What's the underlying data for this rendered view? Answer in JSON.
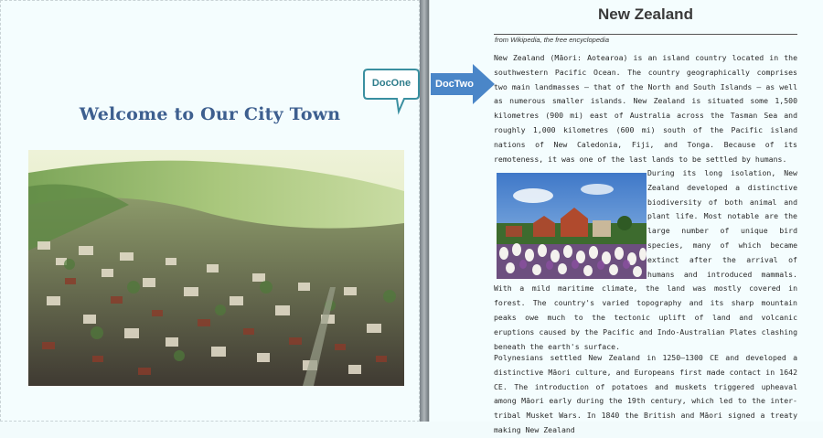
{
  "doc_one": {
    "title": "Welcome to Our City Town",
    "callout_label": "DocOne"
  },
  "doc_two": {
    "arrow_label": "DocTwo",
    "title": "New Zealand",
    "subtitle": "from Wikipedia, the free encyclopedia",
    "paragraph_1": "New Zealand (Māori: Aotearoa) is an island country located in the southwestern Pacific Ocean. The country geographically comprises two main landmasses – that of the North and South Islands – as well as numerous smaller islands. New Zealand is situated some 1,500 kilometres (900 mi) east of Australia across the Tasman Sea and roughly 1,000 kilometres (600 mi) south of the Pacific island nations of New Caledonia, Fiji, and Tonga. Because of its remoteness, it was one of the last lands to be settled by humans.",
    "paragraph_2": "During its long isolation, New Zealand developed a distinctive biodiversity of both animal and plant life. Most notable are the large number of unique bird species, many of which became extinct after the arrival of humans and introduced mammals. With a mild maritime climate, the land was mostly covered in forest. The country's varied topography and its sharp mountain peaks owe much to the tectonic uplift of land and volcanic eruptions caused by the Pacific and Indo-Australian Plates clashing beneath the earth's surface.",
    "paragraph_3": "Polynesians settled New Zealand in 1250–1300 CE and developed a distinctive Māori culture, and Europeans first made contact in 1642 CE. The introduction of potatoes and muskets triggered upheaval among Māori early during the 19th century, which led to the inter-tribal Musket Wars. In 1840 the British and Māori signed a treaty making New Zealand"
  },
  "colors": {
    "left_title": "#3d5f8f",
    "callout_border": "#3a8fa0",
    "arrow_fill": "#4a86c8",
    "page_background": "#f4fdfe"
  }
}
